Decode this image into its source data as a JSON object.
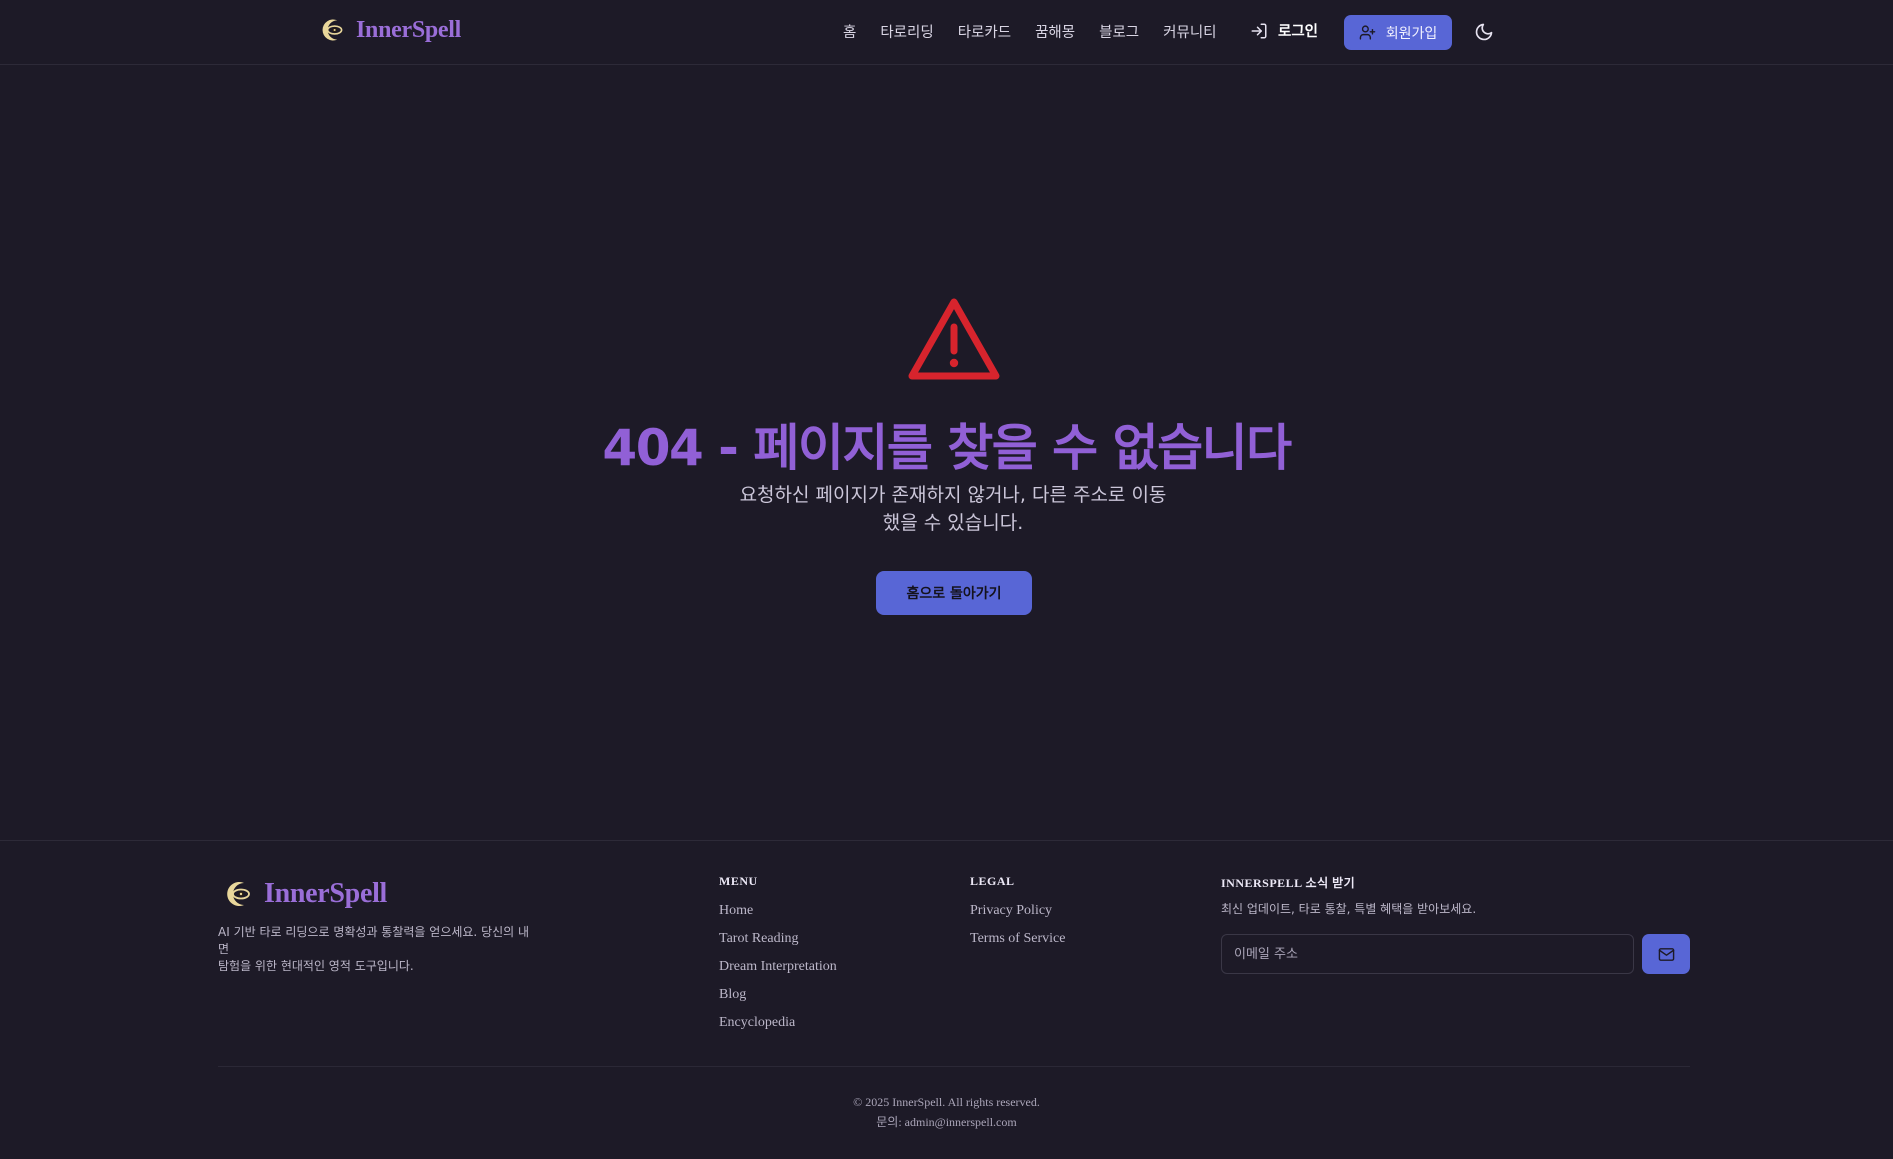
{
  "brand": {
    "name": "InnerSpell",
    "logo_icon": "crescent-eye-icon"
  },
  "nav": {
    "items": [
      {
        "label": "홈"
      },
      {
        "label": "타로리딩"
      },
      {
        "label": "타로카드"
      },
      {
        "label": "꿈해몽"
      },
      {
        "label": "블로그"
      },
      {
        "label": "커뮤니티"
      }
    ],
    "login_label": "로그인",
    "signup_label": "회원가입",
    "theme_icon": "moon-icon"
  },
  "error": {
    "icon": "warning-triangle-icon",
    "title": "404 - 페이지를 찾을 수 없습니다",
    "message_line1": "요청하신 페이지가 존재하지 않거나, 다른 주소로 이동",
    "message_line2": "했을 수 있습니다.",
    "home_button_label": "홈으로 돌아가기"
  },
  "footer": {
    "description_line1": "AI 기반 타로 리딩으로 명확성과 통찰력을 얻으세요. 당신의 내면",
    "description_line2": "탐험을 위한 현대적인 영적 도구입니다.",
    "menu": {
      "title": "MENU",
      "links": [
        {
          "label": "Home"
        },
        {
          "label": "Tarot Reading"
        },
        {
          "label": "Dream Interpretation"
        },
        {
          "label": "Blog"
        },
        {
          "label": "Encyclopedia"
        }
      ]
    },
    "legal": {
      "title": "LEGAL",
      "links": [
        {
          "label": "Privacy Policy"
        },
        {
          "label": "Terms of Service"
        }
      ]
    },
    "newsletter": {
      "title": "INNERSPELL 소식 받기",
      "description": "최신 업데이트, 타로 통찰, 특별 혜택을 받아보세요.",
      "email_placeholder": "이메일 주소",
      "submit_icon": "mail-icon"
    },
    "copyright": "© 2025 InnerSpell. All rights reserved.",
    "contact": "문의: admin@innerspell.com"
  },
  "colors": {
    "background": "#1d1a27",
    "accent": "#5866d6",
    "brand_purple": "#9a6ed8",
    "warning_red": "#d7242d"
  }
}
